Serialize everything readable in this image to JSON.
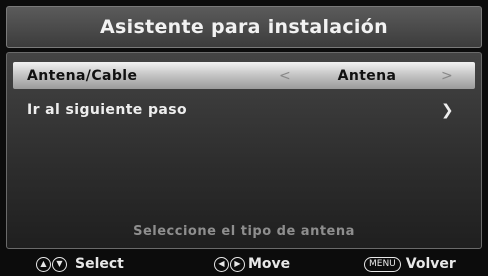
{
  "header": {
    "title": "Asistente para instalación"
  },
  "menu": {
    "antenna_row": {
      "label": "Antena/Cable",
      "value": "Antena",
      "left_icon": "chevron-left-icon",
      "right_icon": "chevron-right-icon"
    },
    "next_row": {
      "label": "Ir al siguiente paso",
      "icon": "chevron-right-icon"
    }
  },
  "hint": "Seleccione el tipo de antena",
  "footer": {
    "select_label": "Select",
    "move_label": "Move",
    "menu_button": "MENU",
    "back_label": "Volver"
  },
  "colors": {
    "highlight": "#cfcfcf",
    "background": "#0c0c0c"
  }
}
